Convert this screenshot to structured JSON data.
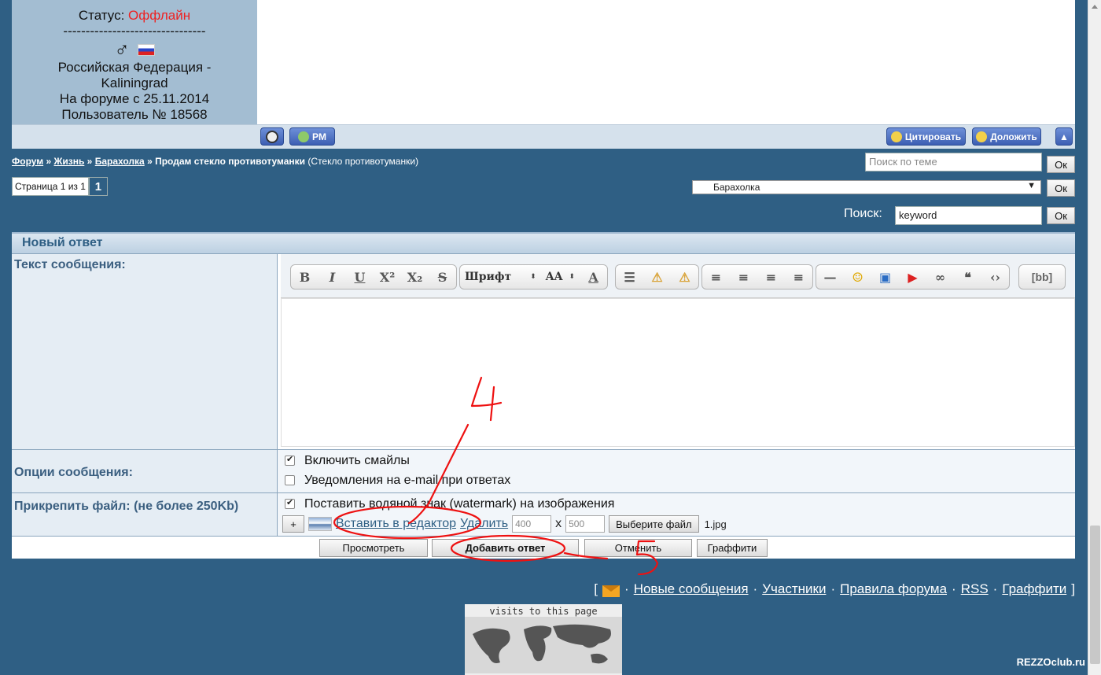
{
  "profile": {
    "status_label": "Статус:",
    "status_value": "Оффлайн",
    "divider": "--------------------------------",
    "gender_symbol": "♂",
    "location": "Российская Федерация - Kaliningrad",
    "joined": "На форуме с 25.11.2014",
    "user_no": "Пользователь № 18568"
  },
  "post_bar": {
    "pm_label": "PM",
    "quote_label": "Цитировать",
    "report_label": "Доложить"
  },
  "breadcrumb": {
    "forum": "Форум",
    "life": "Жизнь",
    "market": "Барахолка",
    "sep": "»",
    "topic": "Продам стекло противотуманки",
    "topic_desc": "(Стекло противотуманки)"
  },
  "topic_search": {
    "placeholder": "Поиск по теме",
    "ok": "Ок"
  },
  "pager": {
    "label": "Страница 1 из 1",
    "current": "1"
  },
  "jump": {
    "selected": "Барахолка",
    "ok": "Ок"
  },
  "search": {
    "label": "Поиск:",
    "value": "keyword",
    "ok": "Ок"
  },
  "form": {
    "title": "Новый ответ",
    "message_label": "Текст сообщения:",
    "options_label": "Опции сообщения:",
    "attach_label": "Прикрепить файл: (не более 250Kb)",
    "toolbar": {
      "bold": "B",
      "italic": "I",
      "underline": "U",
      "sup": "X²",
      "sub": "X₂",
      "strike": "S",
      "font": "Шрифт",
      "size": "AA",
      "color": "A",
      "bb": "[bb]"
    },
    "opt_smiles": "Включить смайлы",
    "opt_email": "Уведомления на e-mail при ответах",
    "opt_watermark": "Поставить водяной знак (watermark) на изображения",
    "attach": {
      "add": "+",
      "insert": "Вставить в редактор",
      "delete": "Удалить",
      "width": "400",
      "x": "x",
      "height": "500",
      "choose": "Выберите файл",
      "filename": "1.jpg"
    }
  },
  "actions": {
    "preview": "Просмотреть",
    "submit": "Добавить ответ",
    "cancel": "Отменить",
    "graffiti": "Граффити"
  },
  "footer": {
    "bracket_open": "[",
    "bracket_close": "]",
    "new_messages": "Новые сообщения",
    "members": "Участники",
    "rules": "Правила форума",
    "rss": "RSS",
    "graffiti": "Граффити",
    "visits": "visits to this page"
  },
  "annotations": {
    "step4": "4",
    "step5": "5"
  },
  "watermark": "REZZOclub.ru"
}
